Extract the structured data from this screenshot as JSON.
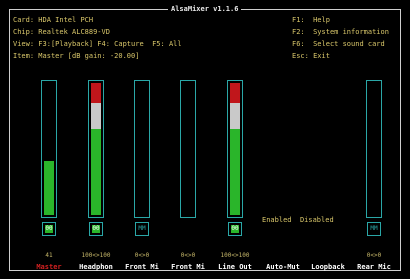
{
  "window": {
    "title": "AlsaMixer v1.1.6"
  },
  "info": {
    "card_label": "Card:",
    "card_value": "HDA Intel PCH",
    "chip_label": "Chip:",
    "chip_value": "Realtek ALC889-VD",
    "view_label": "View:",
    "view_value": "F3:[Playback] F4: Capture  F5: All",
    "item_label": "Item:",
    "item_value": "Master [dB gain: -20.00]"
  },
  "keys": [
    {
      "key": "F1:",
      "action": "Help"
    },
    {
      "key": "F2:",
      "action": "System information"
    },
    {
      "key": "F6:",
      "action": "Select sound card"
    },
    {
      "key": "Esc:",
      "action": "Exit"
    }
  ],
  "channels": [
    {
      "name": "Master",
      "value": "41",
      "selected": true,
      "level": 0.41,
      "switch": "00"
    },
    {
      "name": "Headphon",
      "value": "100<>100",
      "selected": false,
      "level": 1.0,
      "switch": "00"
    },
    {
      "name": "Front Mi",
      "value": "0<>0",
      "selected": false,
      "level": 0,
      "switch": "MM"
    },
    {
      "name": "Front Mi",
      "value": "0<>0",
      "selected": false,
      "level": 0,
      "switch": ""
    },
    {
      "name": "Line Out",
      "value": "100<>100",
      "selected": false,
      "level": 1.0,
      "switch": "00"
    },
    {
      "name": "Auto-Mut",
      "value": "",
      "selected": false,
      "level": null,
      "switch": ""
    },
    {
      "name": "Loopback",
      "value": "",
      "selected": false,
      "level": null,
      "switch": ""
    },
    {
      "name": "Rear Mic",
      "value": "0<>0",
      "selected": false,
      "level": 0,
      "switch": "MM"
    }
  ],
  "enum": {
    "enabled": "Enabled",
    "disabled": "Disabled"
  },
  "colors": {
    "border": "#2aa7a7",
    "high": "#c0161b",
    "mid": "#c9c9c9",
    "low": "#2ab52a",
    "text": "#d8c66a"
  }
}
